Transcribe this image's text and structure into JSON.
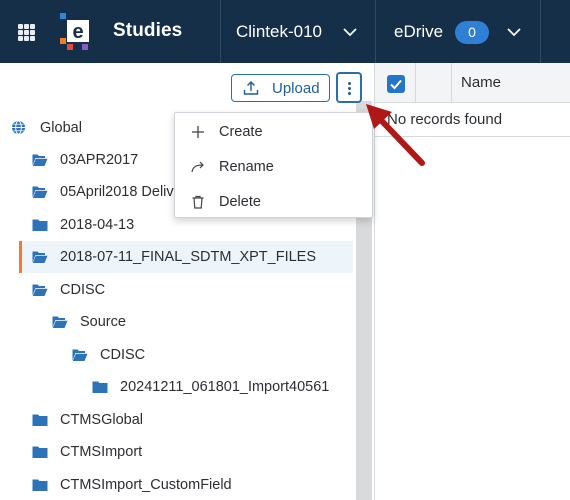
{
  "header": {
    "app_title": "Studies",
    "study": "Clintek-010",
    "drive_label": "eDrive",
    "drive_count": "0",
    "logo_letter": "e"
  },
  "toolbar": {
    "upload_label": "Upload"
  },
  "context_menu": {
    "items": [
      {
        "label": "Create",
        "icon": "plus-icon"
      },
      {
        "label": "Rename",
        "icon": "share-arrow-icon"
      },
      {
        "label": "Delete",
        "icon": "trash-icon"
      }
    ]
  },
  "tree": {
    "root_label": "Global",
    "items": [
      {
        "label": "03APR2017",
        "level": 1,
        "open": true
      },
      {
        "label": "05April2018 Delivery",
        "level": 1,
        "open": true
      },
      {
        "label": "2018-04-13",
        "level": 1,
        "open": false
      },
      {
        "label": "2018-07-11_FINAL_SDTM_XPT_FILES",
        "level": 1,
        "open": true,
        "selected": true
      },
      {
        "label": "CDISC",
        "level": 1,
        "open": true
      },
      {
        "label": "Source",
        "level": 2,
        "open": true
      },
      {
        "label": "CDISC",
        "level": 3,
        "open": true
      },
      {
        "label": "20241211_061801_Import40561",
        "level": 4,
        "open": false
      },
      {
        "label": "CTMSGlobal",
        "level": 1,
        "open": false
      },
      {
        "label": "CTMSImport",
        "level": 1,
        "open": false
      },
      {
        "label": "CTMSImport_CustomField",
        "level": 1,
        "open": false
      }
    ]
  },
  "table": {
    "columns": [
      "Name"
    ],
    "empty_text": "No records found"
  },
  "colors": {
    "header_bg": "#142f47",
    "accent": "#2575c8",
    "folder": "#2c73b8",
    "selected_marker": "#f07c2a",
    "annotation_arrow": "#b01717"
  }
}
